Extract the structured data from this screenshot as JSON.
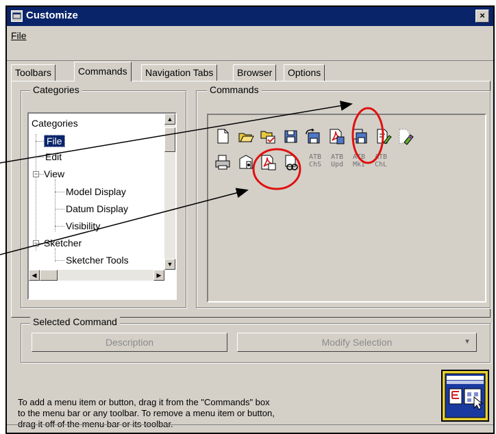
{
  "window": {
    "title": "Customize",
    "close_label": "×"
  },
  "menu": {
    "file": "File"
  },
  "tabs": [
    {
      "label": "Toolbars",
      "active": false
    },
    {
      "label": "Commands",
      "active": true
    },
    {
      "label": "Navigation Tabs",
      "active": false
    },
    {
      "label": "Browser",
      "active": false
    },
    {
      "label": "Options",
      "active": false
    }
  ],
  "categories_group": {
    "legend": "Categories",
    "tree": [
      {
        "label": "Categories",
        "level": 0,
        "selected": false
      },
      {
        "label": "File",
        "level": 1,
        "selected": true
      },
      {
        "label": "Edit",
        "level": 1,
        "selected": false
      },
      {
        "label": "View",
        "level": 1,
        "selected": false,
        "expander": "−"
      },
      {
        "label": "Model Display",
        "level": 2,
        "selected": false
      },
      {
        "label": "Datum Display",
        "level": 2,
        "selected": false
      },
      {
        "label": "Visibility",
        "level": 2,
        "selected": false
      },
      {
        "label": "Sketcher",
        "level": 1,
        "selected": false,
        "expander": "−"
      },
      {
        "label": "Sketcher Tools",
        "level": 2,
        "selected": false
      }
    ]
  },
  "commands_group": {
    "legend": "Commands",
    "row1_icons": [
      "new-file-icon",
      "open-file-icon",
      "select-working-dir-icon",
      "save-icon",
      "save-as-icon",
      "save-pdf-icon",
      "save-copy-icon",
      "rename-icon",
      "erase-icon"
    ],
    "row2_icons": [
      "print-icon",
      "send-mail-icon",
      "pdf-export-icon",
      "linked-file-icon"
    ],
    "atb": [
      {
        "top": "ATB",
        "bottom": "ChS"
      },
      {
        "top": "ATB",
        "bottom": "Upd"
      },
      {
        "top": "ATB",
        "bottom": "MkI"
      },
      {
        "top": "ATB",
        "bottom": "ChL"
      }
    ]
  },
  "selected_command": {
    "legend": "Selected Command",
    "description_button": "Description",
    "modify_selection_button": "Modify Selection"
  },
  "help": {
    "line1": "To add a menu item or button, drag it from the \"Commands\" box",
    "line2": "to the menu bar or any toolbar.  To remove a menu item or button,",
    "line3": "drag it off of the menu bar or its toolbar."
  },
  "colors": {
    "titlebar": "#0a246a",
    "face": "#d4d0c8",
    "highlight": "#0a246a",
    "annotation": "#e01010"
  }
}
